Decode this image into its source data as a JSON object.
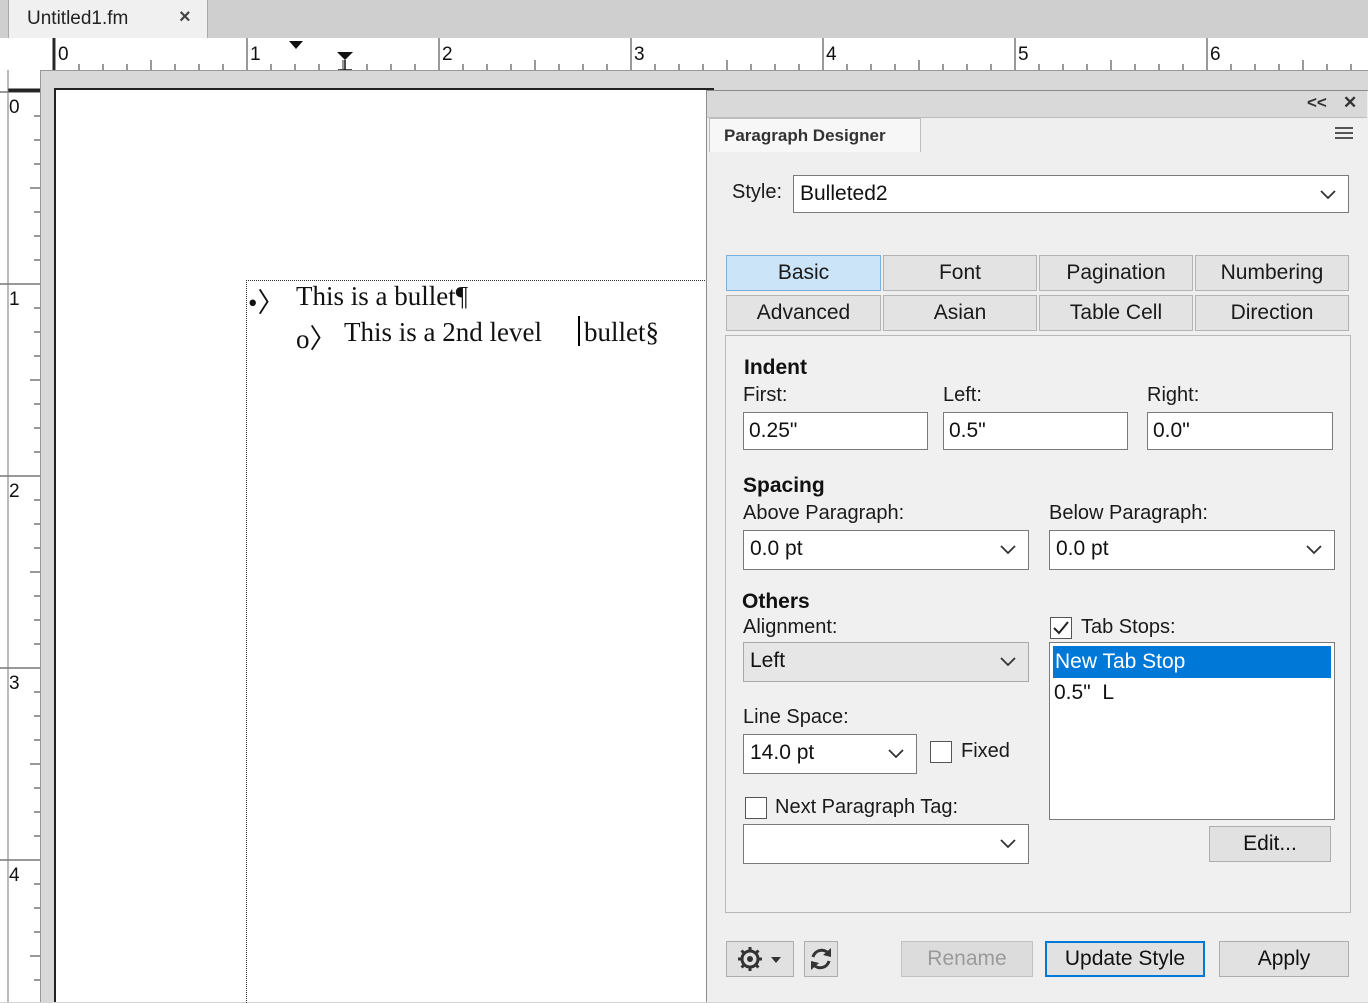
{
  "document": {
    "tab_title": "Untitled1.fm",
    "tab_close_icon": "close-icon",
    "ruler_h_labels": [
      "0",
      "1",
      "2",
      "3",
      "4",
      "5",
      "6"
    ],
    "ruler_v_labels": [
      "0",
      "1",
      "2",
      "3",
      "4"
    ],
    "lines": [
      {
        "marker": "•〉",
        "text": "This is a bullet¶"
      },
      {
        "marker": "o〉",
        "text": "This is a 2nd level",
        "text_after_caret": "bullet§"
      }
    ]
  },
  "panel": {
    "title_buttons": [
      "<<",
      "✕"
    ],
    "tab_label": "Paragraph Designer",
    "style_label": "Style:",
    "style_value": "Bulleted2",
    "tabs_row1": [
      "Basic",
      "Font",
      "Pagination",
      "Numbering"
    ],
    "tabs_row2": [
      "Advanced",
      "Asian",
      "Table Cell",
      "Direction"
    ],
    "selected_tab": "Basic",
    "indent": {
      "heading": "Indent",
      "first_label": "First:",
      "first_value": "0.25\"",
      "left_label": "Left:",
      "left_value": "0.5\"",
      "right_label": "Right:",
      "right_value": "0.0\""
    },
    "spacing": {
      "heading": "Spacing",
      "above_label": "Above Paragraph:",
      "above_value": "0.0 pt",
      "below_label": "Below Paragraph:",
      "below_value": "0.0 pt"
    },
    "others": {
      "heading": "Others",
      "alignment_label": "Alignment:",
      "alignment_value": "Left",
      "line_space_label": "Line Space:",
      "line_space_value": "14.0 pt",
      "fixed_label": "Fixed",
      "fixed_checked": false,
      "next_tag_label": "Next Paragraph Tag:",
      "next_tag_checked": false,
      "next_tag_value": "",
      "tab_stops_label": "Tab Stops:",
      "tab_stops_checked": true,
      "tab_stops": [
        "New Tab Stop",
        "0.5\"  L"
      ],
      "edit_button": "Edit..."
    },
    "footer": {
      "gear_icon": "gear-icon",
      "refresh_icon": "refresh-icon",
      "rename_button": "Rename",
      "update_button": "Update Style",
      "apply_button": "Apply"
    }
  }
}
